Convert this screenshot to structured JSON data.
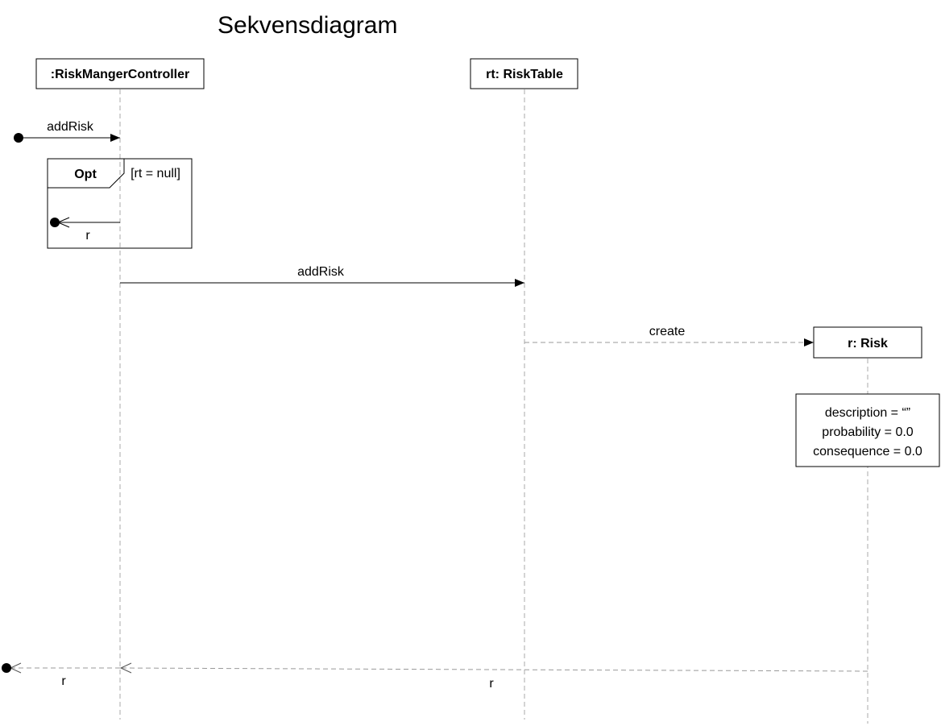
{
  "title": "Sekvensdiagram",
  "lifelines": {
    "controller": ":RiskMangerController",
    "risk_table": "rt: RiskTable",
    "risk": "r: Risk"
  },
  "messages": {
    "found_add_risk": "addRisk",
    "add_risk_to_table": "addRisk",
    "create_risk": "create",
    "opt_return": "r",
    "return_from_risk": "r",
    "final_return": "r"
  },
  "opt_fragment": {
    "operator": "Opt",
    "guard": "[rt = null]"
  },
  "risk_state": {
    "description": "description = “”",
    "probability": "probability = 0.0",
    "consequence": "consequence = 0.0"
  }
}
